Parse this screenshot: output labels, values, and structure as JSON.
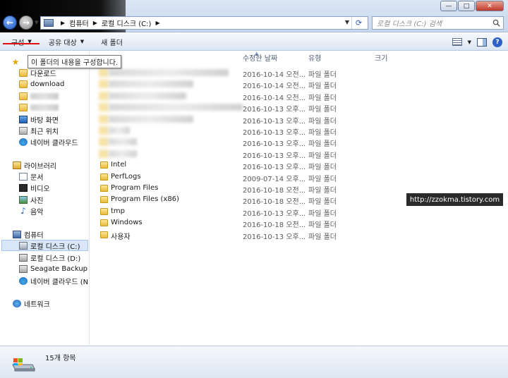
{
  "address": {
    "crumbs": [
      "컴퓨터",
      "로컬 디스크 (C:)"
    ]
  },
  "search": {
    "placeholder": "로컬 디스크 (C:) 검색"
  },
  "toolbar": {
    "organize": "구성",
    "share": "공유 대상",
    "new_folder": "새 폴더"
  },
  "tooltip": "이 폴더의 내용을 구성합니다.",
  "nav": {
    "favorites": [
      {
        "label": "다운로드"
      },
      {
        "label": "download"
      },
      {
        "label": "바탕 화면"
      },
      {
        "label": "최근 위치"
      },
      {
        "label": "네이버 클라우드"
      }
    ],
    "libraries": "라이브러리",
    "library_items": [
      "문서",
      "비디오",
      "사진",
      "음악"
    ],
    "computer": "컴퓨터",
    "drives": [
      "로컬 디스크 (C:)",
      "로컬 디스크 (D:)",
      "Seagate Backup Plu",
      "네이버 클라우드 (N"
    ],
    "network": "네트워크"
  },
  "columns": {
    "date": "수정한 날짜",
    "type": "유형",
    "size": "크기"
  },
  "rows": [
    {
      "name": "",
      "date": "2016-10-14 오전...",
      "type": "파일 폴더",
      "blurred": true
    },
    {
      "name": "",
      "date": "2016-10-14 오전...",
      "type": "파일 폴더",
      "blurred": true
    },
    {
      "name": "",
      "date": "2016-10-14 오전...",
      "type": "파일 폴더",
      "blurred": true
    },
    {
      "name": "",
      "date": "2016-10-13 오후...",
      "type": "파일 폴더",
      "blurred": true
    },
    {
      "name": "",
      "date": "2016-10-13 오후...",
      "type": "파일 폴더",
      "blurred": true
    },
    {
      "name": "",
      "date": "2016-10-13 오후...",
      "type": "파일 폴더",
      "blurred": true
    },
    {
      "name": "",
      "date": "2016-10-13 오후...",
      "type": "파일 폴더",
      "blurred": true
    },
    {
      "name": "",
      "date": "2016-10-13 오후...",
      "type": "파일 폴더",
      "blurred": true
    },
    {
      "name": "Intel",
      "date": "2016-10-13 오후...",
      "type": "파일 폴더"
    },
    {
      "name": "PerfLogs",
      "date": "2009-07-14 오후...",
      "type": "파일 폴더"
    },
    {
      "name": "Program Files",
      "date": "2016-10-18 오전...",
      "type": "파일 폴더"
    },
    {
      "name": "Program Files (x86)",
      "date": "2016-10-18 오전...",
      "type": "파일 폴더"
    },
    {
      "name": "tmp",
      "date": "2016-10-13 오후...",
      "type": "파일 폴더"
    },
    {
      "name": "Windows",
      "date": "2016-10-18 오전...",
      "type": "파일 폴더"
    },
    {
      "name": "사용자",
      "date": "2016-10-13 오후...",
      "type": "파일 폴더"
    }
  ],
  "watermark": "http://zzokma.tistory.com",
  "status": "15개 항목"
}
